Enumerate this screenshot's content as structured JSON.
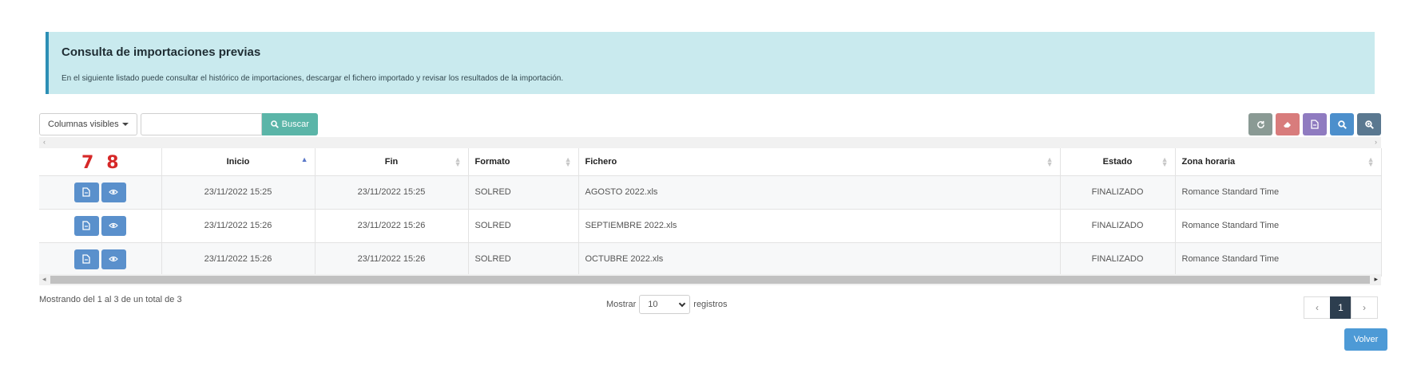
{
  "info": {
    "title": "Consulta de importaciones previas",
    "text": "En el siguiente listado puede consultar el histórico de importaciones, descargar el fichero importado y revisar los resultados de la importación."
  },
  "toolbar": {
    "columns_label": "Columnas visibles",
    "search_value": "",
    "search_label": "Buscar",
    "right_buttons": [
      "refresh-icon",
      "eraser-icon",
      "export-file-icon",
      "search-icon",
      "zoom-icon"
    ]
  },
  "table": {
    "annotation_numbers": [
      "7",
      "8"
    ],
    "headers": [
      "",
      "Inicio",
      "Fin",
      "Formato",
      "Fichero",
      "Estado",
      "Zona horaria"
    ],
    "rows": [
      {
        "inicio": "23/11/2022 15:25",
        "fin": "23/11/2022 15:25",
        "formato": "SOLRED",
        "fichero": "AGOSTO 2022.xls",
        "estado": "FINALIZADO",
        "zona": "Romance Standard Time"
      },
      {
        "inicio": "23/11/2022 15:26",
        "fin": "23/11/2022 15:26",
        "formato": "SOLRED",
        "fichero": "SEPTIEMBRE 2022.xls",
        "estado": "FINALIZADO",
        "zona": "Romance Standard Time"
      },
      {
        "inicio": "23/11/2022 15:26",
        "fin": "23/11/2022 15:26",
        "formato": "SOLRED",
        "fichero": "OCTUBRE 2022.xls",
        "estado": "FINALIZADO",
        "zona": "Romance Standard Time"
      }
    ]
  },
  "footer": {
    "showing": "Mostrando del 1 al 3 de un total de 3",
    "length_prefix": "Mostrar",
    "length_value": "10",
    "length_suffix": "registros",
    "pager_prev": "‹",
    "pager_page": "1",
    "pager_next": "›",
    "back_label": "Volver"
  },
  "colors": {
    "info_bg": "#c9eaee",
    "search_button": "#5bb5a8",
    "action_button": "#5a90cc",
    "annotation": "#d62828",
    "pager_active": "#2d3e4f",
    "back_button": "#4d9ad6"
  }
}
